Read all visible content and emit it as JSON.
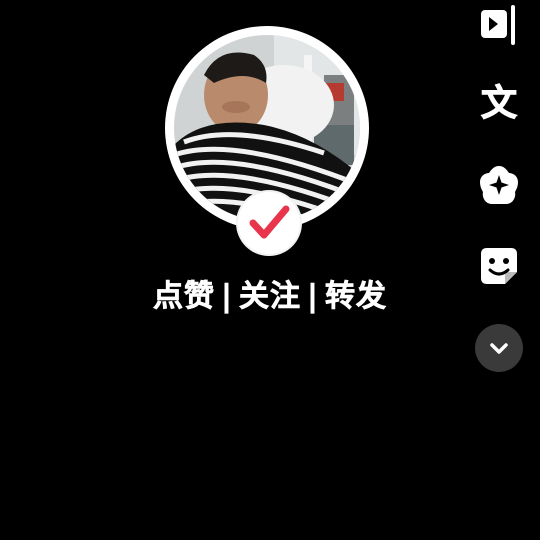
{
  "caption": {
    "part1": "点赞",
    "part2": "关注",
    "part3": "转发",
    "separator": "|"
  },
  "avatar": {
    "badge_icon": "checkmark-icon",
    "badge_color": "#e8354c"
  },
  "right_toolbar": {
    "text_tool_label": "文",
    "items": [
      {
        "icon": "flip-icon"
      },
      {
        "icon": "text-icon"
      },
      {
        "icon": "effects-icon"
      },
      {
        "icon": "sticker-icon"
      },
      {
        "icon": "chevron-down-icon"
      }
    ]
  },
  "colors": {
    "background": "#000000",
    "foreground": "#ffffff",
    "more_button_bg": "#3a3a3a"
  }
}
